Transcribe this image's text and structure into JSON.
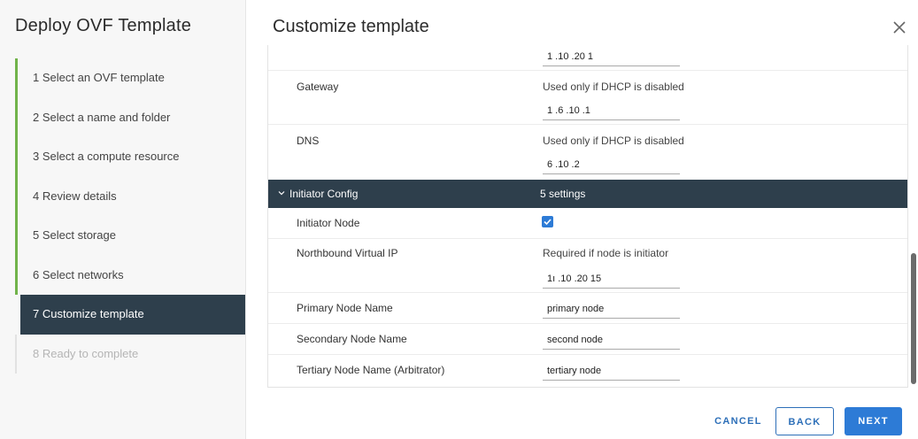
{
  "wizard": {
    "title": "Deploy OVF Template",
    "steps": [
      {
        "label": "1  Select an OVF template"
      },
      {
        "label": "2  Select a name and folder"
      },
      {
        "label": "3  Select a compute resource"
      },
      {
        "label": "4  Review details"
      },
      {
        "label": "5  Select storage"
      },
      {
        "label": "6  Select networks"
      },
      {
        "label": "7  Customize template"
      },
      {
        "label": "8  Ready to complete"
      }
    ]
  },
  "page": {
    "title": "Customize template"
  },
  "form": {
    "top_value": "1  .10  .20   1",
    "gateway": {
      "label": "Gateway",
      "hint": "Used only if DHCP is disabled",
      "value": "1   .6  .10  .1"
    },
    "dns": {
      "label": "DNS",
      "hint": "Used only if DHCP is disabled",
      "value": "6  .10          .2"
    },
    "group": {
      "name": "Initiator Config",
      "count": "5 settings"
    },
    "initiator_node": {
      "label": "Initiator Node",
      "checked": true
    },
    "northbound_vip": {
      "label": "Northbound Virtual IP",
      "hint": "Required if node is initiator",
      "value": "1ı  .10  .20  15"
    },
    "primary_node": {
      "label": "Primary Node Name",
      "value": "primary node"
    },
    "secondary_node": {
      "label": "Secondary Node Name",
      "value": "second node"
    },
    "tertiary_node": {
      "label": "Tertiary Node Name (Arbitrator)",
      "value": "tertiary node"
    }
  },
  "footer": {
    "cancel": "CANCEL",
    "back": "BACK",
    "next": "NEXT"
  },
  "colors": {
    "accent": "#2d7bd6",
    "header_dark": "#2e3f4c",
    "step_done": "#71b34a"
  },
  "icons": {
    "close": "close-icon",
    "chevron": "chevron-down-icon",
    "check": "check-icon"
  }
}
